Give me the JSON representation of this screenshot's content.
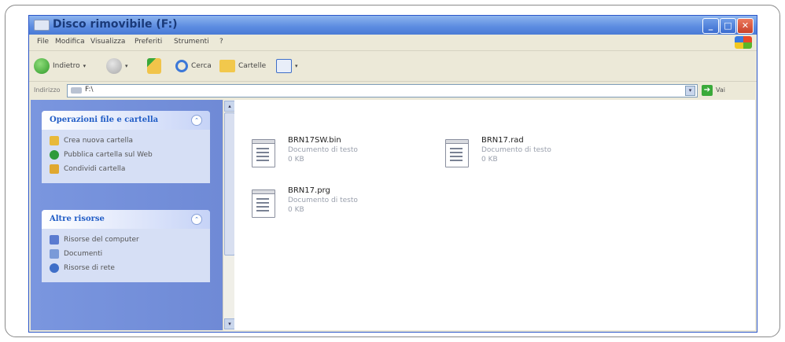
{
  "window": {
    "title": "Disco rimovibile (F:)",
    "controls": {
      "minimize": "_",
      "maximize": "□",
      "close": "✕"
    }
  },
  "menu": [
    "File",
    "Modifica",
    "Visualizza",
    "Preferiti",
    "Strumenti",
    "?"
  ],
  "toolbar": {
    "back_label": "Indietro",
    "back_arrow": "▾",
    "forward_arrow": "▾",
    "search_label": "Cerca",
    "folders_label": "Cartelle",
    "views_arrow": "▾"
  },
  "address": {
    "label": "Indirizzo",
    "path": "F:\\",
    "dropdown": "▾",
    "go_arrow": "➔",
    "go_label": "Vai"
  },
  "tasks_panel": {
    "title": "Operazioni file e cartella",
    "toggle": "⌃",
    "items": [
      {
        "label": "Crea nuova cartella",
        "icon": "new-folder-icon",
        "color": "#e8b93a"
      },
      {
        "label": "Pubblica cartella sul Web",
        "icon": "web-publish-icon",
        "color": "#2f9a3a"
      },
      {
        "label": "Condividi cartella",
        "icon": "share-folder-icon",
        "color": "#e0a830"
      }
    ]
  },
  "other_panel": {
    "title": "Altre risorse",
    "toggle": "⌃",
    "items": [
      {
        "label": "Risorse del computer",
        "icon": "my-computer-icon",
        "color": "#5a7bd0"
      },
      {
        "label": "Documenti",
        "icon": "documents-icon",
        "color": "#7a9ad8"
      },
      {
        "label": "Risorse di rete",
        "icon": "network-icon",
        "color": "#3f6fc8"
      }
    ]
  },
  "scrollbar": {
    "up": "▴",
    "down": "▾"
  },
  "files": [
    {
      "name": "BRN17SW.bin",
      "type": "Documento di testo",
      "size": "0 KB"
    },
    {
      "name": "BRN17.rad",
      "type": "Documento di testo",
      "size": "0 KB"
    },
    {
      "name": "BRN17.prg",
      "type": "Documento di testo",
      "size": "0 KB"
    }
  ],
  "colors": {
    "titlebar": "#5b8be0",
    "task_pane": "#7a96df",
    "panel_title": "#215dc6"
  }
}
